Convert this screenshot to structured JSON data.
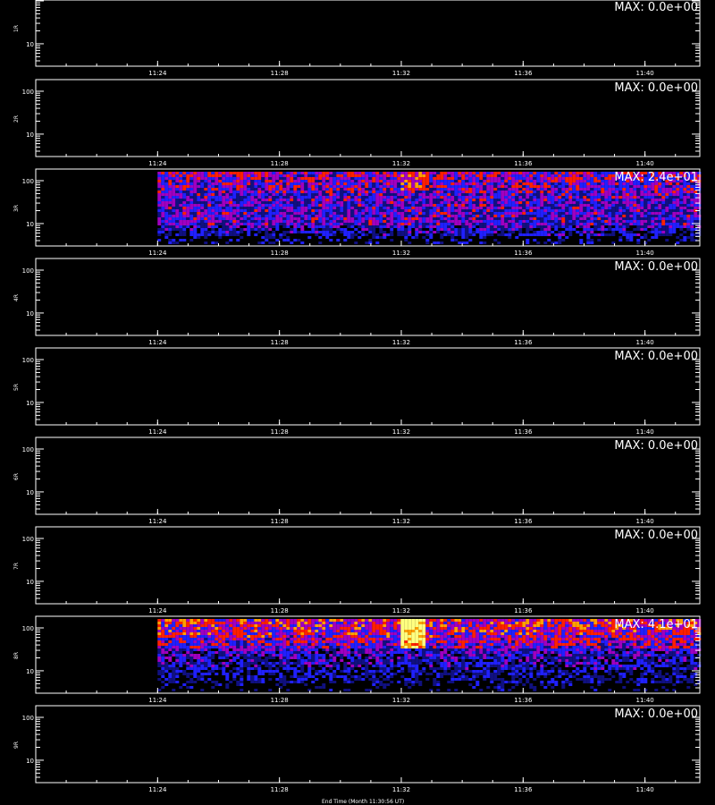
{
  "chart_data": {
    "type": "heatmap",
    "title": "",
    "x_tick_labels": [
      "11:24",
      "11:28",
      "11:32",
      "11:36",
      "11:40"
    ],
    "x_tick_minutes": [
      24,
      28,
      32,
      36,
      40
    ],
    "x_range_minutes": [
      20.0,
      41.8
    ],
    "data_start_minute": 24.0,
    "y_tick_labels": [
      "100",
      "10"
    ],
    "y_scale": "log",
    "y_range": [
      3,
      100
    ],
    "colormap": [
      "#000000",
      "#101080",
      "#2020ff",
      "#a000c0",
      "#ff2000",
      "#ffa000",
      "#ffff80"
    ],
    "burst": {
      "minute": 32.3,
      "y_min": 30,
      "y_max": 100
    },
    "panels": [
      {
        "label": "1R",
        "max_label": "MAX: 0.0e+00",
        "max": 0.0
      },
      {
        "label": "2R",
        "max_label": "MAX: 0.0e+00",
        "max": 0.0
      },
      {
        "label": "3R",
        "max_label": "MAX: 2.4e+01",
        "max": 24.0
      },
      {
        "label": "4R",
        "max_label": "MAX: 0.0e+00",
        "max": 0.0
      },
      {
        "label": "5R",
        "max_label": "MAX: 0.0e+00",
        "max": 0.0
      },
      {
        "label": "6R",
        "max_label": "MAX: 0.0e+00",
        "max": 0.0
      },
      {
        "label": "7R",
        "max_label": "MAX: 0.0e+00",
        "max": 0.0
      },
      {
        "label": "8R",
        "max_label": "MAX: 4.1e+01",
        "max": 41.0
      },
      {
        "label": "9R",
        "max_label": "MAX: 0.0e+00",
        "max": 0.0
      }
    ]
  },
  "footer_text": "End Time (Month 11:30:56 UT)"
}
